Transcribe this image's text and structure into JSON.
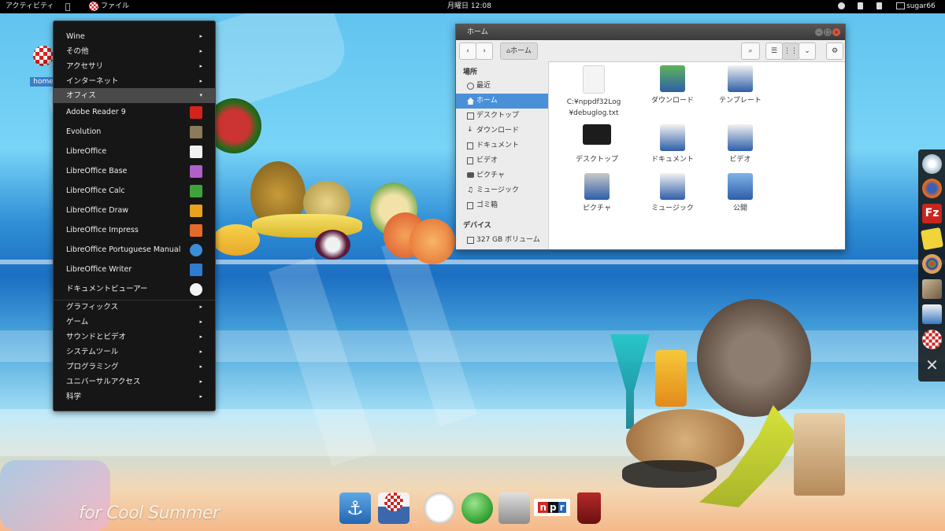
{
  "top_panel": {
    "activities": "アクティビティ",
    "app_label": "ファイル",
    "clock": "月曜日 12:08",
    "user": "sugar66"
  },
  "desktop": {
    "home_icon_label": "home"
  },
  "wallpaper_text": "for Cool Summer",
  "app_menu": {
    "categories_top": [
      {
        "label": "Wine",
        "arrow": "▸"
      },
      {
        "label": "その他",
        "arrow": "▸"
      },
      {
        "label": "アクセサリ",
        "arrow": "▸"
      },
      {
        "label": "インターネット",
        "arrow": "▸"
      }
    ],
    "open_category": {
      "label": "オフィス",
      "arrow": "▾"
    },
    "apps": [
      {
        "label": "Adobe Reader 9",
        "icon": "adobe-reader-icon",
        "color": "#d4231b"
      },
      {
        "label": "Evolution",
        "icon": "evolution-icon",
        "color": "#8b7b5a"
      },
      {
        "label": "LibreOffice",
        "icon": "libreoffice-icon",
        "color": "#f2f2f2"
      },
      {
        "label": "LibreOffice Base",
        "icon": "libreoffice-base-icon",
        "color": "#b15fc9"
      },
      {
        "label": "LibreOffice Calc",
        "icon": "libreoffice-calc-icon",
        "color": "#3fa33b"
      },
      {
        "label": "LibreOffice Draw",
        "icon": "libreoffice-draw-icon",
        "color": "#e8a21d"
      },
      {
        "label": "LibreOffice Impress",
        "icon": "libreoffice-impress-icon",
        "color": "#e36a2a"
      },
      {
        "label": "LibreOffice Portuguese Manual",
        "icon": "help-globe-icon",
        "color": "#3a8fd6"
      },
      {
        "label": "LibreOffice Writer",
        "icon": "libreoffice-writer-icon",
        "color": "#2e7bd0"
      },
      {
        "label": "ドキュメントビューアー",
        "icon": "document-viewer-icon",
        "color": "#f4f4f4"
      }
    ],
    "categories_bottom": [
      {
        "label": "グラフィックス",
        "arrow": "▸"
      },
      {
        "label": "ゲーム",
        "arrow": "▸"
      },
      {
        "label": "サウンドとビデオ",
        "arrow": "▸"
      },
      {
        "label": "システムツール",
        "arrow": "▸"
      },
      {
        "label": "プログラミング",
        "arrow": "▸"
      },
      {
        "label": "ユニバーサルアクセス",
        "arrow": "▸"
      },
      {
        "label": "科学",
        "arrow": "▸"
      }
    ]
  },
  "file_manager": {
    "title": "ホーム",
    "path_button": "ホーム",
    "sidebar": {
      "places_header": "場所",
      "places": [
        {
          "label": "最近",
          "icon": "clock-icon"
        },
        {
          "label": "ホーム",
          "icon": "home-icon",
          "selected": true
        },
        {
          "label": "デスクトップ",
          "icon": "folder-icon"
        },
        {
          "label": "ダウンロード",
          "icon": "download-icon"
        },
        {
          "label": "ドキュメント",
          "icon": "folder-icon"
        },
        {
          "label": "ビデオ",
          "icon": "folder-icon"
        },
        {
          "label": "ピクチャ",
          "icon": "camera-icon"
        },
        {
          "label": "ミュージック",
          "icon": "music-icon"
        },
        {
          "label": "ゴミ箱",
          "icon": "trash-icon"
        }
      ],
      "devices_header": "デバイス",
      "devices": [
        {
          "label": "327 GB ボリューム",
          "icon": "drive-icon"
        }
      ]
    },
    "items": [
      {
        "label": "C:¥nppdf32Log ¥debuglog.txt",
        "icon": "text-file-icon",
        "color": "#f4f4f4"
      },
      {
        "label": "ダウンロード",
        "icon": "download-folder-icon",
        "color": "#2e5ea8"
      },
      {
        "label": "テンプレート",
        "icon": "templates-folder-icon",
        "color": "#2e5ea8"
      },
      {
        "label": "デスクトップ",
        "icon": "desktop-folder-icon",
        "color": "#1c1c1c"
      },
      {
        "label": "ドキュメント",
        "icon": "documents-folder-icon",
        "color": "#2e5ea8"
      },
      {
        "label": "ビデオ",
        "icon": "videos-folder-icon",
        "color": "#2e5ea8"
      },
      {
        "label": "ピクチャ",
        "icon": "pictures-folder-icon",
        "color": "#2e5ea8"
      },
      {
        "label": "ミュージック",
        "icon": "music-folder-icon",
        "color": "#2e5ea8"
      },
      {
        "label": "公開",
        "icon": "public-folder-icon",
        "color": "#2e5ea8"
      }
    ]
  },
  "right_dock": [
    {
      "icon": "chromium-icon",
      "color": "#c9d6e3"
    },
    {
      "icon": "firefox-icon",
      "color": "#e66a1b"
    },
    {
      "icon": "filezilla-icon",
      "color": "#c8261d"
    },
    {
      "icon": "notes-icon",
      "color": "#f0d43a"
    },
    {
      "icon": "palette-icon",
      "color": "#d9a15a"
    },
    {
      "icon": "photo-icon",
      "color": "#9c8a6f"
    },
    {
      "icon": "screenshot-icon",
      "color": "#3a78c2"
    },
    {
      "icon": "amiga-icon",
      "color": "#cc2222"
    },
    {
      "icon": "tools-icon",
      "color": "#bfbfbf"
    }
  ],
  "bottom_dock": [
    {
      "icon": "anchor-icon",
      "color": "#3a88d4"
    },
    {
      "icon": "amiga-drive-icon",
      "color": "#3b67ad"
    },
    {
      "icon": "separator-icon",
      "color": "#dddddd"
    },
    {
      "icon": "clock-app-icon",
      "color": "#eeeeee"
    },
    {
      "icon": "green-orb-icon",
      "color": "#3da83a"
    },
    {
      "icon": "monitor-icon",
      "color": "#b5b5b5"
    },
    {
      "icon": "npr-icon",
      "color": "#d8261c",
      "text": "npr"
    },
    {
      "icon": "trash-can-icon",
      "color": "#8e1a1a"
    }
  ]
}
